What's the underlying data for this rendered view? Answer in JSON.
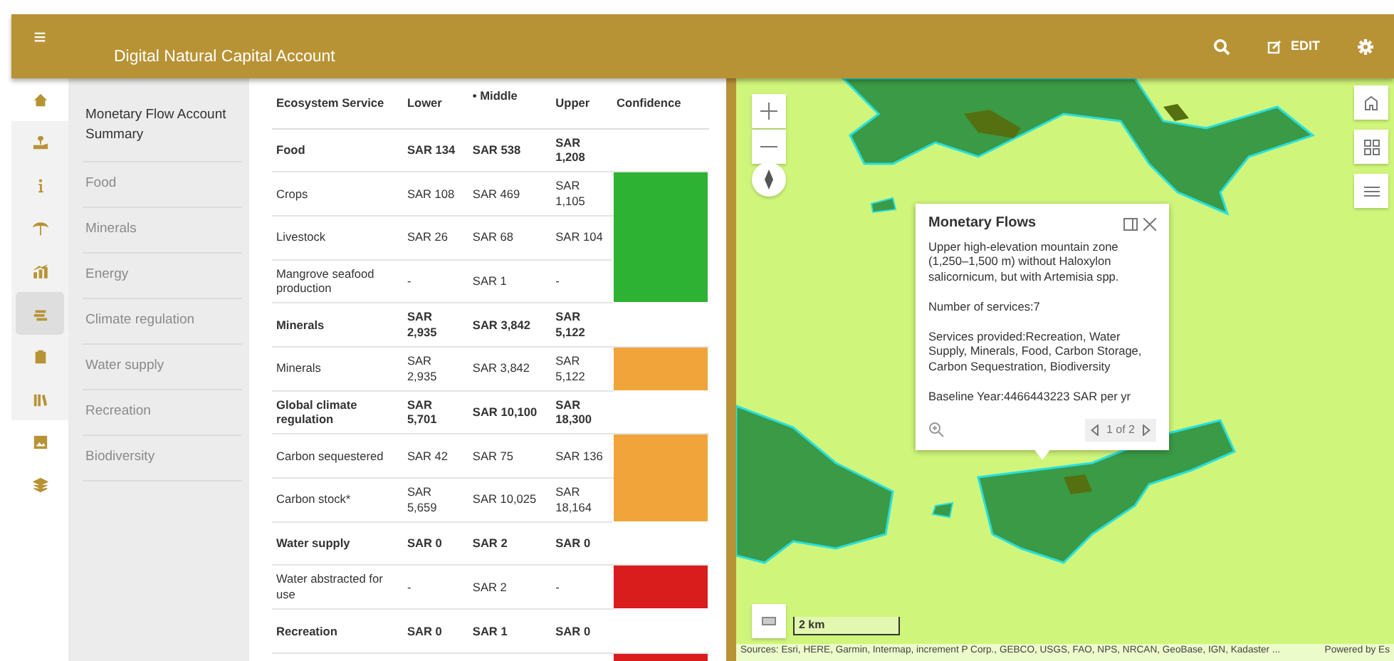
{
  "header": {
    "menu_icon": "≡",
    "title": "Digital Natural Capital Account",
    "edit_label": "EDIT"
  },
  "rail": [
    {
      "selected": false
    },
    {
      "selected": false
    },
    {
      "selected": false
    },
    {
      "selected": false
    },
    {
      "selected": false
    },
    {
      "selected": true
    },
    {
      "selected": false
    },
    {
      "selected": false
    },
    {
      "selected": false
    },
    {
      "selected": false
    }
  ],
  "nav": [
    {
      "label": "Monetary Flow Account Summary",
      "kind": "title"
    },
    {
      "label": "Food",
      "kind": "link"
    },
    {
      "label": "Minerals",
      "kind": "link"
    },
    {
      "label": "Energy",
      "kind": "link"
    },
    {
      "label": "Climate regulation",
      "kind": "link"
    },
    {
      "label": "Water supply",
      "kind": "link"
    },
    {
      "label": "Recreation",
      "kind": "link"
    },
    {
      "label": "Biodiversity",
      "kind": "link"
    }
  ],
  "table": {
    "columns": [
      "Ecosystem Service",
      "Lower",
      "• Middle",
      "Upper",
      "Confidence"
    ],
    "groups": [
      {
        "service": "Food",
        "lower": "SAR 134",
        "middle": "SAR 538",
        "upper": "SAR 1,208",
        "color": "#2db233",
        "items": [
          {
            "service": "Crops",
            "lower": "SAR 108",
            "middle": "SAR 469",
            "upper": "SAR 1,105"
          },
          {
            "service": "Livestock",
            "lower": "SAR 26",
            "middle": "SAR 68",
            "upper": "SAR 104"
          },
          {
            "service": "Mangrove seafood production",
            "lower": "-",
            "middle": "SAR 1",
            "upper": "-"
          }
        ]
      },
      {
        "service": "Minerals",
        "lower": "SAR 2,935",
        "middle": "SAR 3,842",
        "upper": "SAR 5,122",
        "color": "#f0a43a",
        "items": [
          {
            "service": "Minerals",
            "lower": "SAR 2,935",
            "middle": "SAR 3,842",
            "upper": "SAR 5,122"
          }
        ]
      },
      {
        "service": "Global climate regulation",
        "lower": "SAR 5,701",
        "middle": "SAR 10,100",
        "upper": "SAR 18,300",
        "color": "#f0a43a",
        "items": [
          {
            "service": "Carbon sequestered",
            "lower": "SAR 42",
            "middle": "SAR 75",
            "upper": "SAR 136"
          },
          {
            "service": "Carbon stock*",
            "lower": "SAR 5,659",
            "middle": "SAR 10,025",
            "upper": "SAR 18,164"
          }
        ]
      },
      {
        "service": "Water supply",
        "lower": "SAR 0",
        "middle": "SAR 2",
        "upper": "SAR 0",
        "color": "#d91c1c",
        "items": [
          {
            "service": "Water abstracted for use",
            "lower": "-",
            "middle": "SAR 2",
            "upper": "-"
          }
        ]
      },
      {
        "service": "Recreation",
        "lower": "SAR 0",
        "middle": "SAR 1",
        "upper": "SAR 0",
        "color": "#d91c1c"
      }
    ]
  },
  "map": {
    "popup": {
      "title": "Monetary Flows",
      "paragraphs": [
        "Upper high-elevation mountain zone (1,250–1,500 m) without Haloxylon salicornicum, but with Artemisia spp.",
        "Number of services:7",
        "Services provided:Recreation, Water Supply, Minerals, Food, Carbon Storage, Carbon Sequestration, Biodiversity",
        "Baseline Year:4466443223 SAR per yr"
      ],
      "pager": "1 of 2"
    },
    "scale": "2 km",
    "attribution": "Sources: Esri, HERE, Garmin, Intermap, increment P Corp., GEBCO, USGS, FAO, NPS, NRCAN, GeoBase, IGN, Kadaster ...",
    "powered_by": "Powered by Es"
  }
}
